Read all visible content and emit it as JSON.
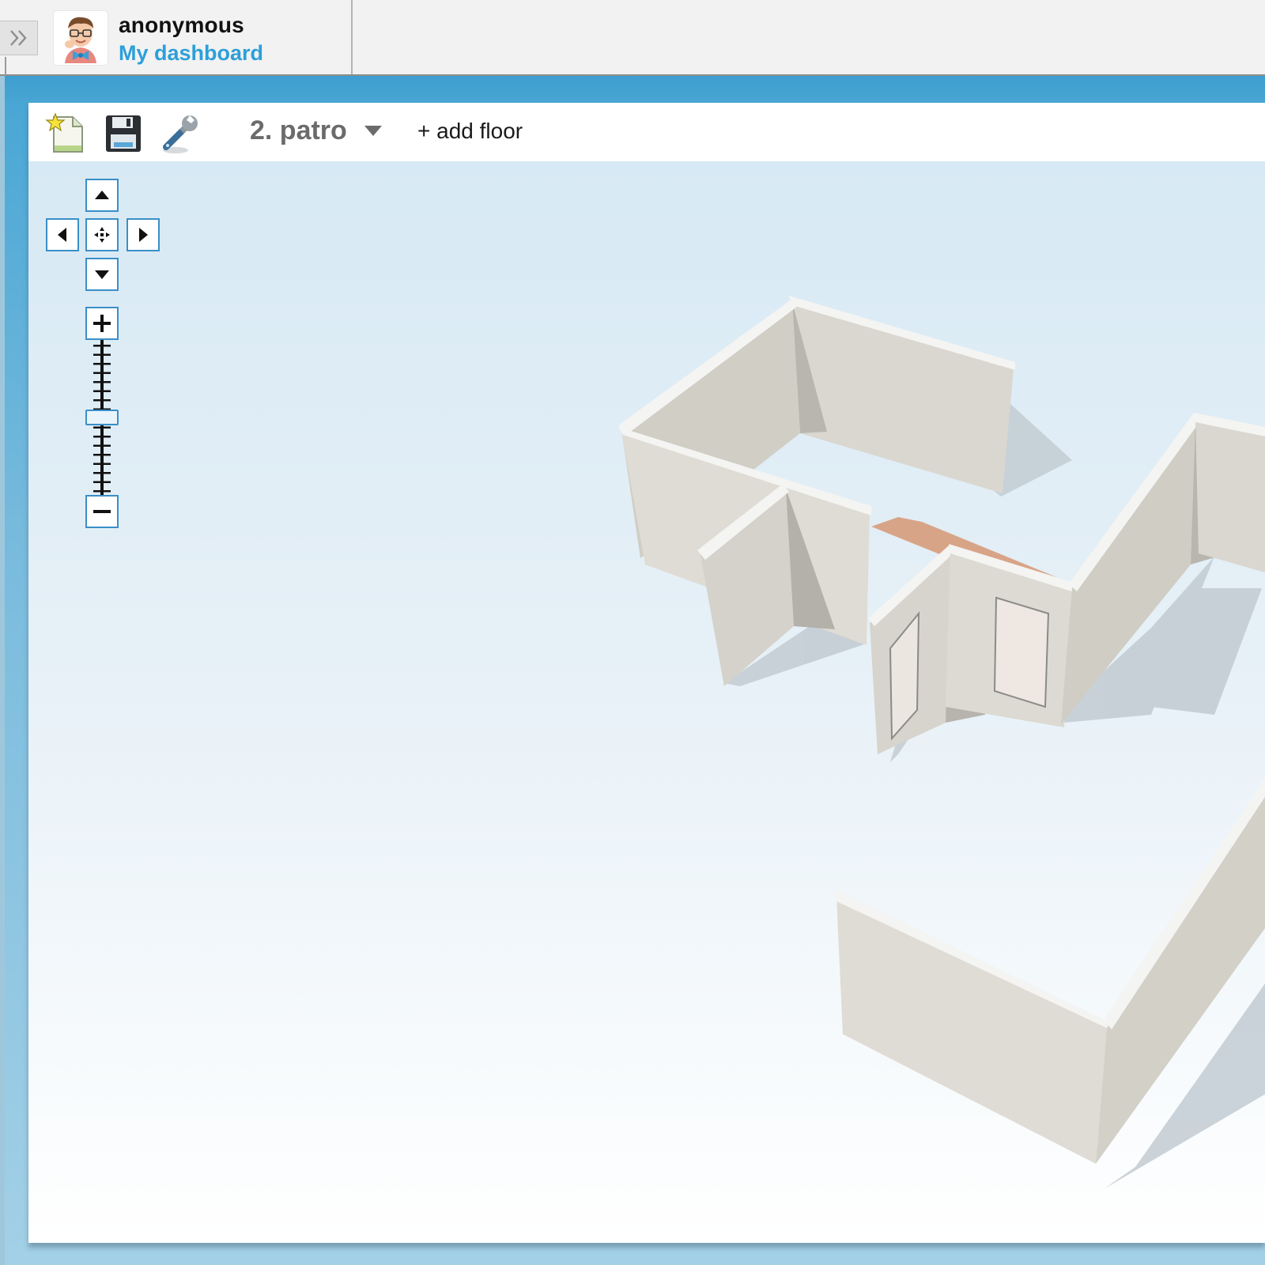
{
  "user": {
    "name": "anonymous",
    "dashboard_link": "My dashboard"
  },
  "toolbar": {
    "floor_selected": "2. patro",
    "add_floor_label": "+ add floor"
  },
  "icons": {
    "expand": "double-chevron-right-icon",
    "avatar": "user-avatar",
    "new_plan": "new-document-icon",
    "save": "save-floppy-icon",
    "settings": "wrench-icon",
    "floor_dropdown": "caret-down-icon",
    "pan_up": "arrow-up-icon",
    "pan_down": "arrow-down-icon",
    "pan_left": "arrow-left-icon",
    "pan_right": "arrow-right-icon",
    "center": "center-view-icon",
    "zoom_in": "plus-icon",
    "zoom_out": "minus-icon"
  },
  "zoom": {
    "level_fraction": 0.5
  },
  "colors": {
    "frame_blue": "#4aa7d5",
    "link_blue": "#2d9fd9",
    "control_border": "#3a8fc7",
    "wall_face": "#dcdad2",
    "wall_top": "#f4f4f2",
    "floor_accent": "#d8a487"
  }
}
